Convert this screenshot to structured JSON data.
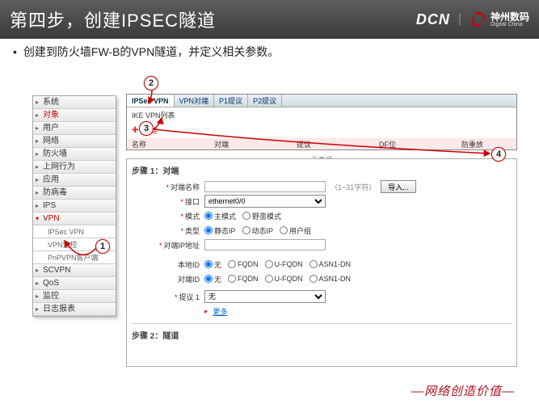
{
  "header": {
    "title": "第四步，创建IPSEC隧道",
    "brand_dcn": "DCN",
    "brand_cn": "神州数码",
    "brand_en": "Digital China"
  },
  "subhead": "创建到防火墙FW-B的VPN隧道，并定义相关参数。",
  "sidebar": {
    "items": [
      {
        "label": "系统"
      },
      {
        "label": "对象",
        "active": true
      },
      {
        "label": "用户"
      },
      {
        "label": "网络"
      },
      {
        "label": "防火墙"
      },
      {
        "label": "上网行为"
      },
      {
        "label": "应用"
      },
      {
        "label": "防病毒"
      },
      {
        "label": "IPS"
      },
      {
        "label": "VPN",
        "expanded": true,
        "active": true
      },
      {
        "label": "IPSec VPN",
        "sub": true,
        "active": true
      },
      {
        "label": "VPN监控",
        "sub": true
      },
      {
        "label": "PnPVPN客户端",
        "sub": true
      },
      {
        "label": "SCVPN"
      },
      {
        "label": "QoS"
      },
      {
        "label": "监控"
      },
      {
        "label": "日志报表"
      }
    ]
  },
  "tabs": [
    "IPSec VPN",
    "VPN对端",
    "P1提议",
    "P2提议"
  ],
  "ike_title": "IKE VPN列表",
  "ike_new": "新建",
  "table_headers": {
    "name": "名称",
    "peer": "对端",
    "proposal": "提议",
    "df": "DF位",
    "replay": "防重放"
  },
  "table_empty": "无表项",
  "steps": {
    "s1": "步骤 1：对端",
    "s2": "步骤 2：隧道"
  },
  "form": {
    "peer_name": {
      "label": "对端名称",
      "hint": "（1~31字符）",
      "btn": "导入..."
    },
    "interface": {
      "label": "接口",
      "value": "ethernet0/0"
    },
    "mode": {
      "label": "模式",
      "options": [
        "主模式",
        "野蛮模式"
      ],
      "selected": 0
    },
    "type": {
      "label": "类型",
      "options": [
        "静态IP",
        "动态IP",
        "用户组"
      ],
      "selected": 0
    },
    "peer_ip": {
      "label": "对端IP地址"
    },
    "local_id": {
      "label": "本地ID",
      "options": [
        "无",
        "FQDN",
        "U-FQDN",
        "ASN1-DN"
      ],
      "selected": 0
    },
    "peer_id": {
      "label": "对端ID",
      "options": [
        "无",
        "FQDN",
        "U-FQDN",
        "ASN1-DN"
      ],
      "selected": 0
    },
    "proposal": {
      "label": "提议 1",
      "value": "无"
    },
    "more": "更多"
  },
  "callouts": {
    "1": "1",
    "2": "2",
    "3": "3",
    "4": "4"
  },
  "footer": "网络创造价值"
}
